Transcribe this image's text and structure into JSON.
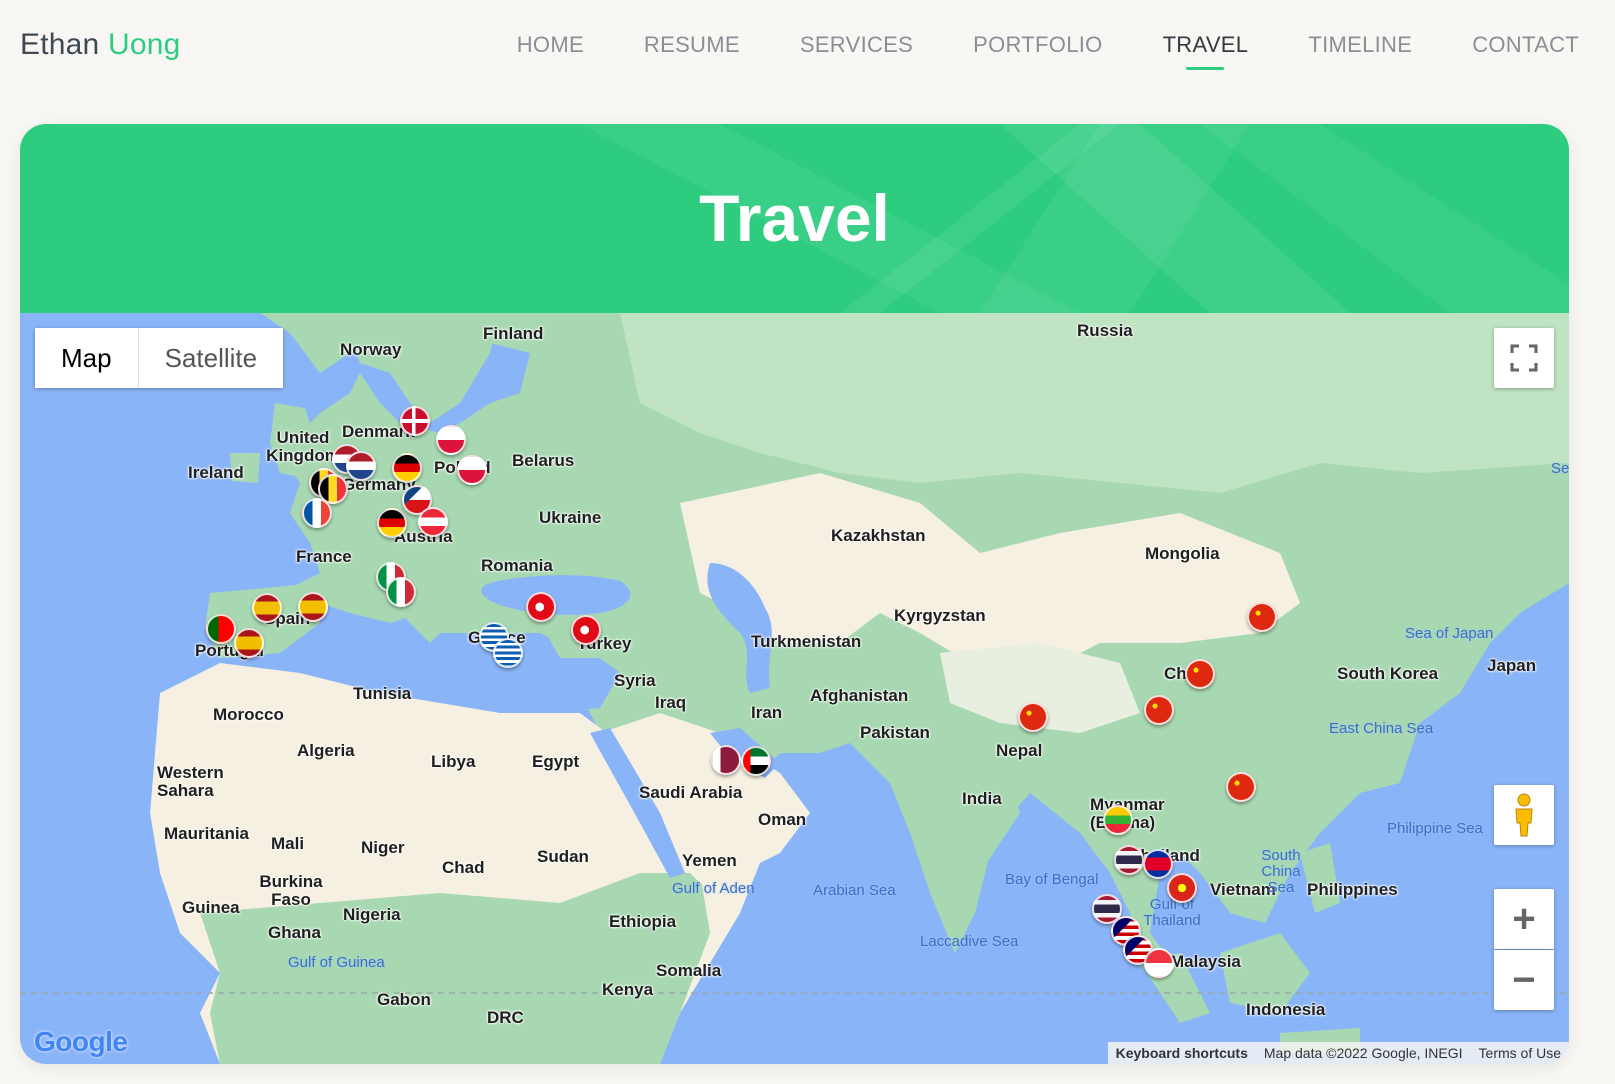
{
  "brand": {
    "first": "Ethan",
    "last": "Uong"
  },
  "nav": {
    "items": [
      {
        "label": "HOME",
        "active": false
      },
      {
        "label": "RESUME",
        "active": false
      },
      {
        "label": "SERVICES",
        "active": false
      },
      {
        "label": "PORTFOLIO",
        "active": false
      },
      {
        "label": "TRAVEL",
        "active": true
      },
      {
        "label": "TIMELINE",
        "active": false
      },
      {
        "label": "CONTACT",
        "active": false
      }
    ]
  },
  "card": {
    "title": "Travel"
  },
  "map": {
    "map_type_buttons": {
      "map": "Map",
      "satellite": "Satellite"
    },
    "controls": {
      "fullscreen_icon": "fullscreen-icon",
      "pegman_icon": "pegman-icon",
      "zoom_in": "+",
      "zoom_out": "−"
    },
    "logo": "Google",
    "footer": {
      "shortcuts": "Keyboard shortcuts",
      "map_data": "Map data ©2022 Google, INEGI",
      "terms": "Terms of Use"
    },
    "country_labels": {
      "norway": "Norway",
      "finland": "Finland",
      "russia": "Russia",
      "denmark": "Denmark",
      "uk": "United Kingdom",
      "ireland": "Ireland",
      "belarus": "Belarus",
      "poland": "Poland",
      "germany": "Germany",
      "ukraine": "Ukraine",
      "austria": "Austria",
      "france": "France",
      "romania": "Romania",
      "spain": "Spain",
      "portugal": "Portugal",
      "greece": "Greece",
      "turkey": "Turkey",
      "syria": "Syria",
      "iraq": "Iraq",
      "iran": "Iran",
      "kazakhstan": "Kazakhstan",
      "mongolia": "Mongolia",
      "kyrgyzstan": "Kyrgyzstan",
      "turkmenistan": "Turkmenistan",
      "afghanistan": "Afghanistan",
      "pakistan": "Pakistan",
      "nepal": "Nepal",
      "india": "India",
      "china": "China",
      "south_korea": "South Korea",
      "japan": "Japan",
      "myanmar": "Myanmar (Burma)",
      "thailand": "Thailand",
      "vietnam": "Vietnam",
      "philippines": "Philippines",
      "malaysia": "Malaysia",
      "indonesia": "Indonesia",
      "tunisia": "Tunisia",
      "morocco": "Morocco",
      "algeria": "Algeria",
      "libya": "Libya",
      "egypt": "Egypt",
      "saudi_arabia": "Saudi Arabia",
      "oman": "Oman",
      "yemen": "Yemen",
      "western_sahara": "Western Sahara",
      "mauritania": "Mauritania",
      "mali": "Mali",
      "niger": "Niger",
      "chad": "Chad",
      "sudan": "Sudan",
      "burkina_faso": "Burkina Faso",
      "guinea": "Guinea",
      "nigeria": "Nigeria",
      "ghana": "Ghana",
      "ethiopia": "Ethiopia",
      "somalia": "Somalia",
      "kenya": "Kenya",
      "gabon": "Gabon",
      "drc": "DRC"
    },
    "sea_labels": {
      "sea_of_japan": "Sea of Japan",
      "east_china_sea": "East China Sea",
      "philippine_sea": "Philippine Sea",
      "south_china_sea": "South China Sea",
      "bay_of_bengal": "Bay of Bengal",
      "arabian_sea": "Arabian Sea",
      "laccadive_sea": "Laccadive Sea",
      "gulf_of_aden": "Gulf of Aden",
      "gulf_of_guinea": "Gulf of Guinea",
      "gulf_of_thailand": "Gulf of Thailand",
      "sea_of_okhotsk": "Sea of Okhotsk"
    },
    "markers": [
      {
        "country": "Denmark"
      },
      {
        "country": "Poland"
      },
      {
        "country": "Poland"
      },
      {
        "country": "Netherlands"
      },
      {
        "country": "Netherlands"
      },
      {
        "country": "Germany"
      },
      {
        "country": "Belgium"
      },
      {
        "country": "Belgium"
      },
      {
        "country": "Czech Republic"
      },
      {
        "country": "France"
      },
      {
        "country": "Germany"
      },
      {
        "country": "Austria"
      },
      {
        "country": "Italy"
      },
      {
        "country": "Italy"
      },
      {
        "country": "Spain"
      },
      {
        "country": "Spain"
      },
      {
        "country": "Portugal"
      },
      {
        "country": "Spain"
      },
      {
        "country": "Turkey"
      },
      {
        "country": "Turkey"
      },
      {
        "country": "Greece"
      },
      {
        "country": "Greece"
      },
      {
        "country": "Qatar"
      },
      {
        "country": "United Arab Emirates"
      },
      {
        "country": "China"
      },
      {
        "country": "China"
      },
      {
        "country": "China"
      },
      {
        "country": "China"
      },
      {
        "country": "China"
      },
      {
        "country": "Myanmar"
      },
      {
        "country": "Thailand"
      },
      {
        "country": "Cambodia"
      },
      {
        "country": "Vietnam"
      },
      {
        "country": "Thailand"
      },
      {
        "country": "Malaysia"
      },
      {
        "country": "Malaysia"
      },
      {
        "country": "Singapore"
      }
    ]
  }
}
